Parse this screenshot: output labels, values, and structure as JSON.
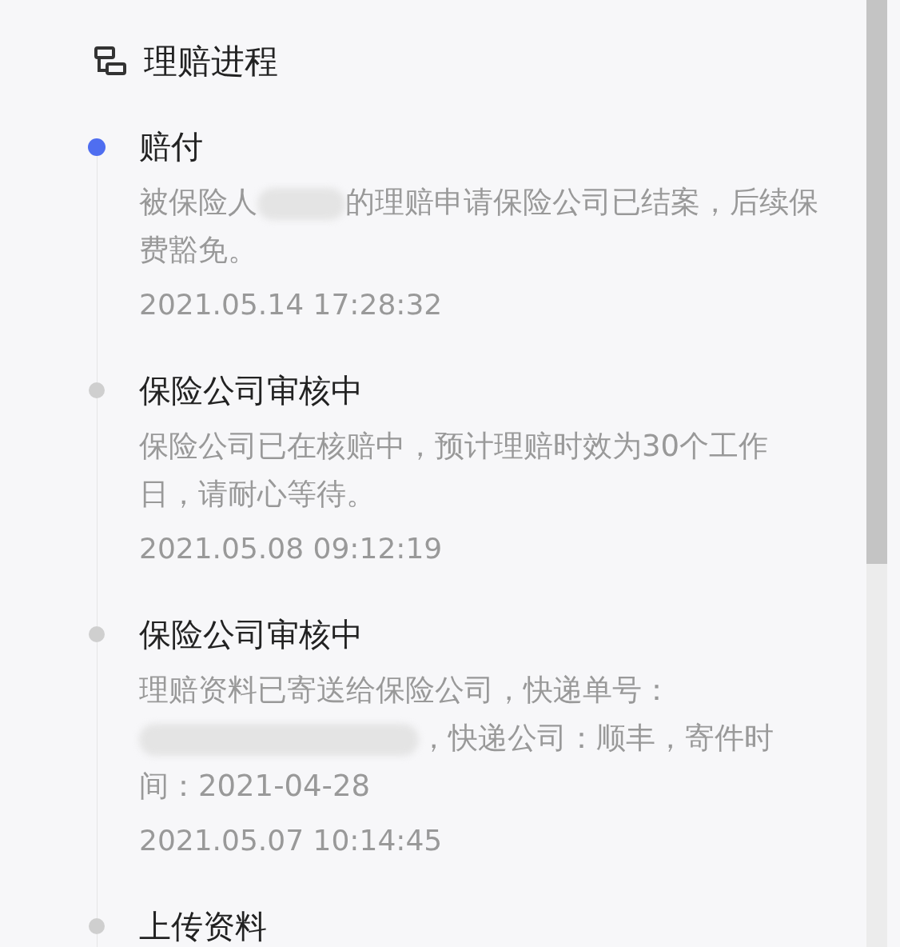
{
  "header": {
    "title": "理赔进程"
  },
  "steps": [
    {
      "title": "赔付",
      "selected": true,
      "body": [
        {
          "kind": "text",
          "text": "被保险人"
        },
        {
          "kind": "redacted"
        },
        {
          "kind": "text",
          "text": "的理赔申请保险公司已结案，后续保费豁免。"
        }
      ],
      "time": "2021.05.14 17:28:32"
    },
    {
      "title": "保险公司审核中",
      "selected": false,
      "body": [
        {
          "kind": "text",
          "text": "保险公司已在核赔中，预计理赔时效为30个工作日，请耐心等待。"
        }
      ],
      "time": "2021.05.08 09:12:19"
    },
    {
      "title": "保险公司审核中",
      "selected": false,
      "body": [
        {
          "kind": "text",
          "text": "理赔资料已寄送给保险公司，快递单号："
        },
        {
          "kind": "redacted"
        },
        {
          "kind": "text",
          "text": "，快递公司：顺丰，寄件时间：2021-04-28"
        }
      ],
      "time": "2021.05.07 10:14:45"
    },
    {
      "title": "上传资料",
      "selected": false
    }
  ]
}
